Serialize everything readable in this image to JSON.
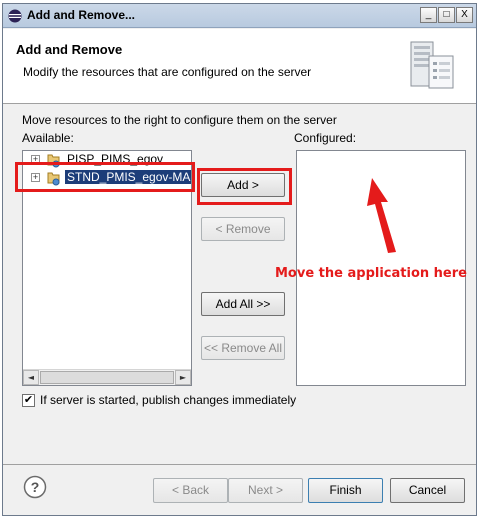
{
  "window": {
    "title": "Add and Remove...",
    "min_glyph": "_",
    "max_glyph": "□",
    "close_glyph": "X"
  },
  "header": {
    "title": "Add and Remove",
    "description": "Modify the resources that are configured on the server"
  },
  "instructions": "Move resources to the right to configure them on the server",
  "available": {
    "label": "Available:",
    "items": [
      {
        "label": "PISP_PIMS_egov",
        "selected": false,
        "expander": "+"
      },
      {
        "label": "STND_PMIS_egov-MASTER",
        "selected": true,
        "expander": "+"
      }
    ],
    "scroll_left": "◄",
    "scroll_right": "►"
  },
  "configured": {
    "label": "Configured:"
  },
  "buttons": {
    "add": "Add >",
    "remove": "< Remove",
    "add_all": "Add All >>",
    "remove_all": "<< Remove All"
  },
  "annotation": {
    "text": "Move the application here",
    "color": "#e41b1b"
  },
  "publish_checkbox": {
    "checked": true,
    "mark": "✔",
    "label": "If server is started, publish changes immediately"
  },
  "footer": {
    "help": "?",
    "back": "< Back",
    "next": "Next >",
    "finish": "Finish",
    "cancel": "Cancel"
  },
  "colors": {
    "selection": "#1c3d79",
    "highlight": "#e41b1b",
    "dialog_bg": "#f0f0f0"
  }
}
